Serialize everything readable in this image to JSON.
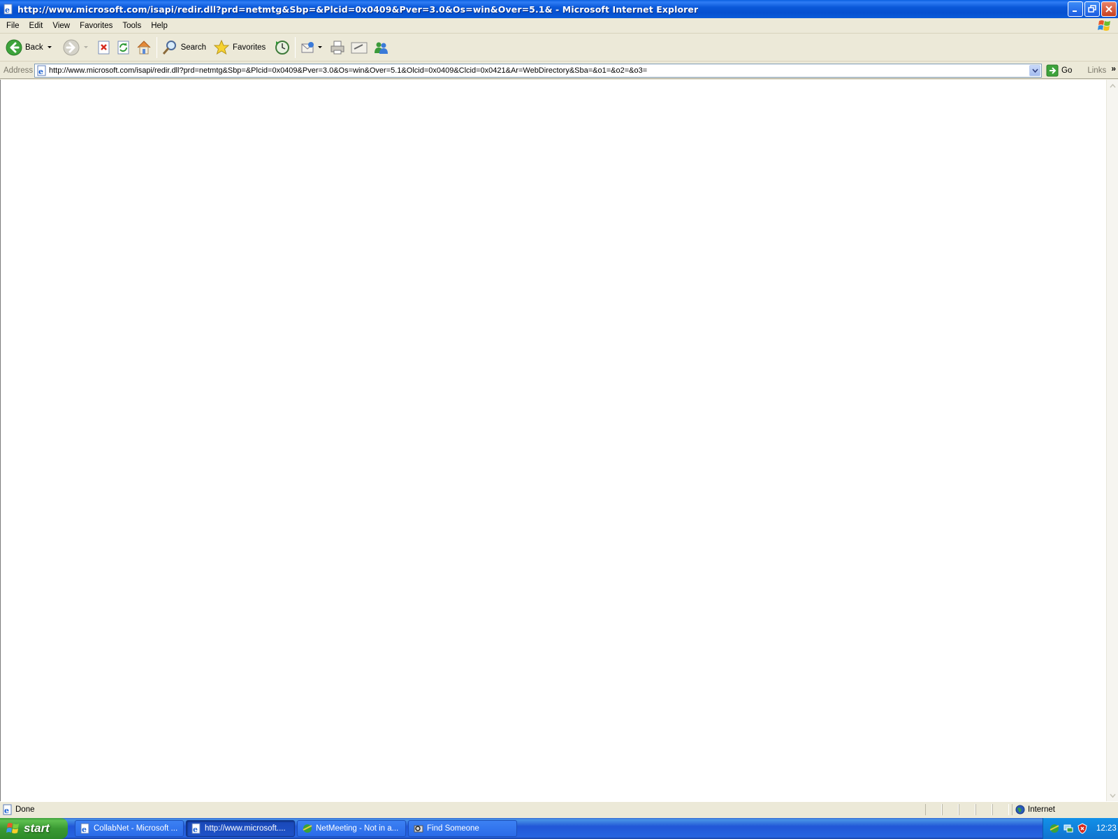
{
  "window": {
    "title": "http://www.microsoft.com/isapi/redir.dll?prd=netmtg&Sbp=&Plcid=0x0409&Pver=3.0&Os=win&Over=5.1& - Microsoft Internet Explorer"
  },
  "menu": {
    "items": [
      {
        "label": "File"
      },
      {
        "label": "Edit"
      },
      {
        "label": "View"
      },
      {
        "label": "Favorites"
      },
      {
        "label": "Tools"
      },
      {
        "label": "Help"
      }
    ]
  },
  "toolbar": {
    "back_label": "Back",
    "search_label": "Search",
    "favorites_label": "Favorites"
  },
  "address": {
    "label": "Address",
    "url": "http://www.microsoft.com/isapi/redir.dll?prd=netmtg&Sbp=&Plcid=0x0409&Pver=3.0&Os=win&Over=5.1&Olcid=0x0409&Clcid=0x0421&Ar=WebDirectory&Sba=&o1=&o2=&o3=",
    "go_label": "Go",
    "links_label": "Links"
  },
  "status": {
    "text": "Done",
    "zone": "Internet"
  },
  "taskbar": {
    "start_label": "start",
    "tasks": [
      {
        "label": "CollabNet - Microsoft ...",
        "icon": "ie-page-icon"
      },
      {
        "label": "http://www.microsoft....",
        "icon": "ie-page-icon"
      },
      {
        "label": "NetMeeting - Not in a...",
        "icon": "netmeeting-icon"
      },
      {
        "label": "Find Someone",
        "icon": "find-someone-icon"
      }
    ],
    "clock": "12:23"
  },
  "colors": {
    "titlebar": "#0A58D8",
    "taskbar": "#2157D7",
    "start_button": "#3A9A33",
    "tray": "#0F74D0",
    "chrome": "#ECE9D8"
  }
}
